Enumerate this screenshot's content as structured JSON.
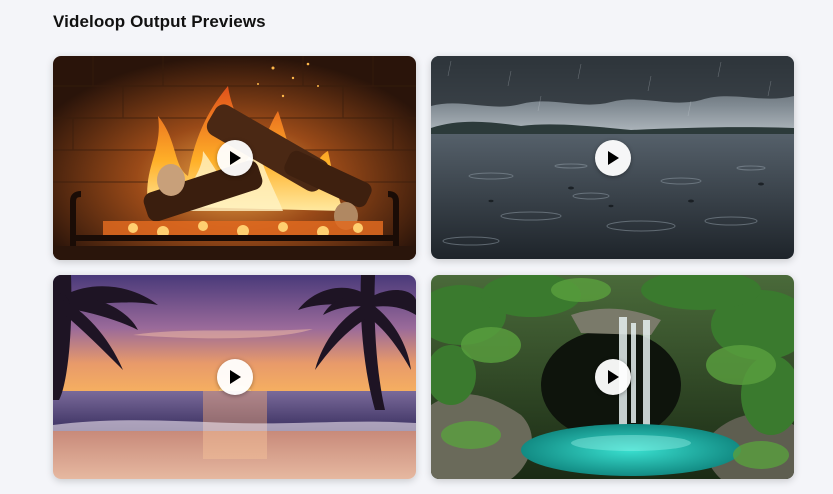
{
  "header": {
    "title": "Videloop Output Previews"
  },
  "previews": [
    {
      "scene_icon": "fireplace",
      "action_icon": "play-icon"
    },
    {
      "scene_icon": "rain-on-lake",
      "action_icon": "play-icon"
    },
    {
      "scene_icon": "beach-sunset",
      "action_icon": "play-icon"
    },
    {
      "scene_icon": "jungle-waterfall",
      "action_icon": "play-icon"
    }
  ],
  "colors": {
    "page_background": "#f4f5f9",
    "play_button": "#ffffff",
    "play_glyph": "#000000"
  }
}
